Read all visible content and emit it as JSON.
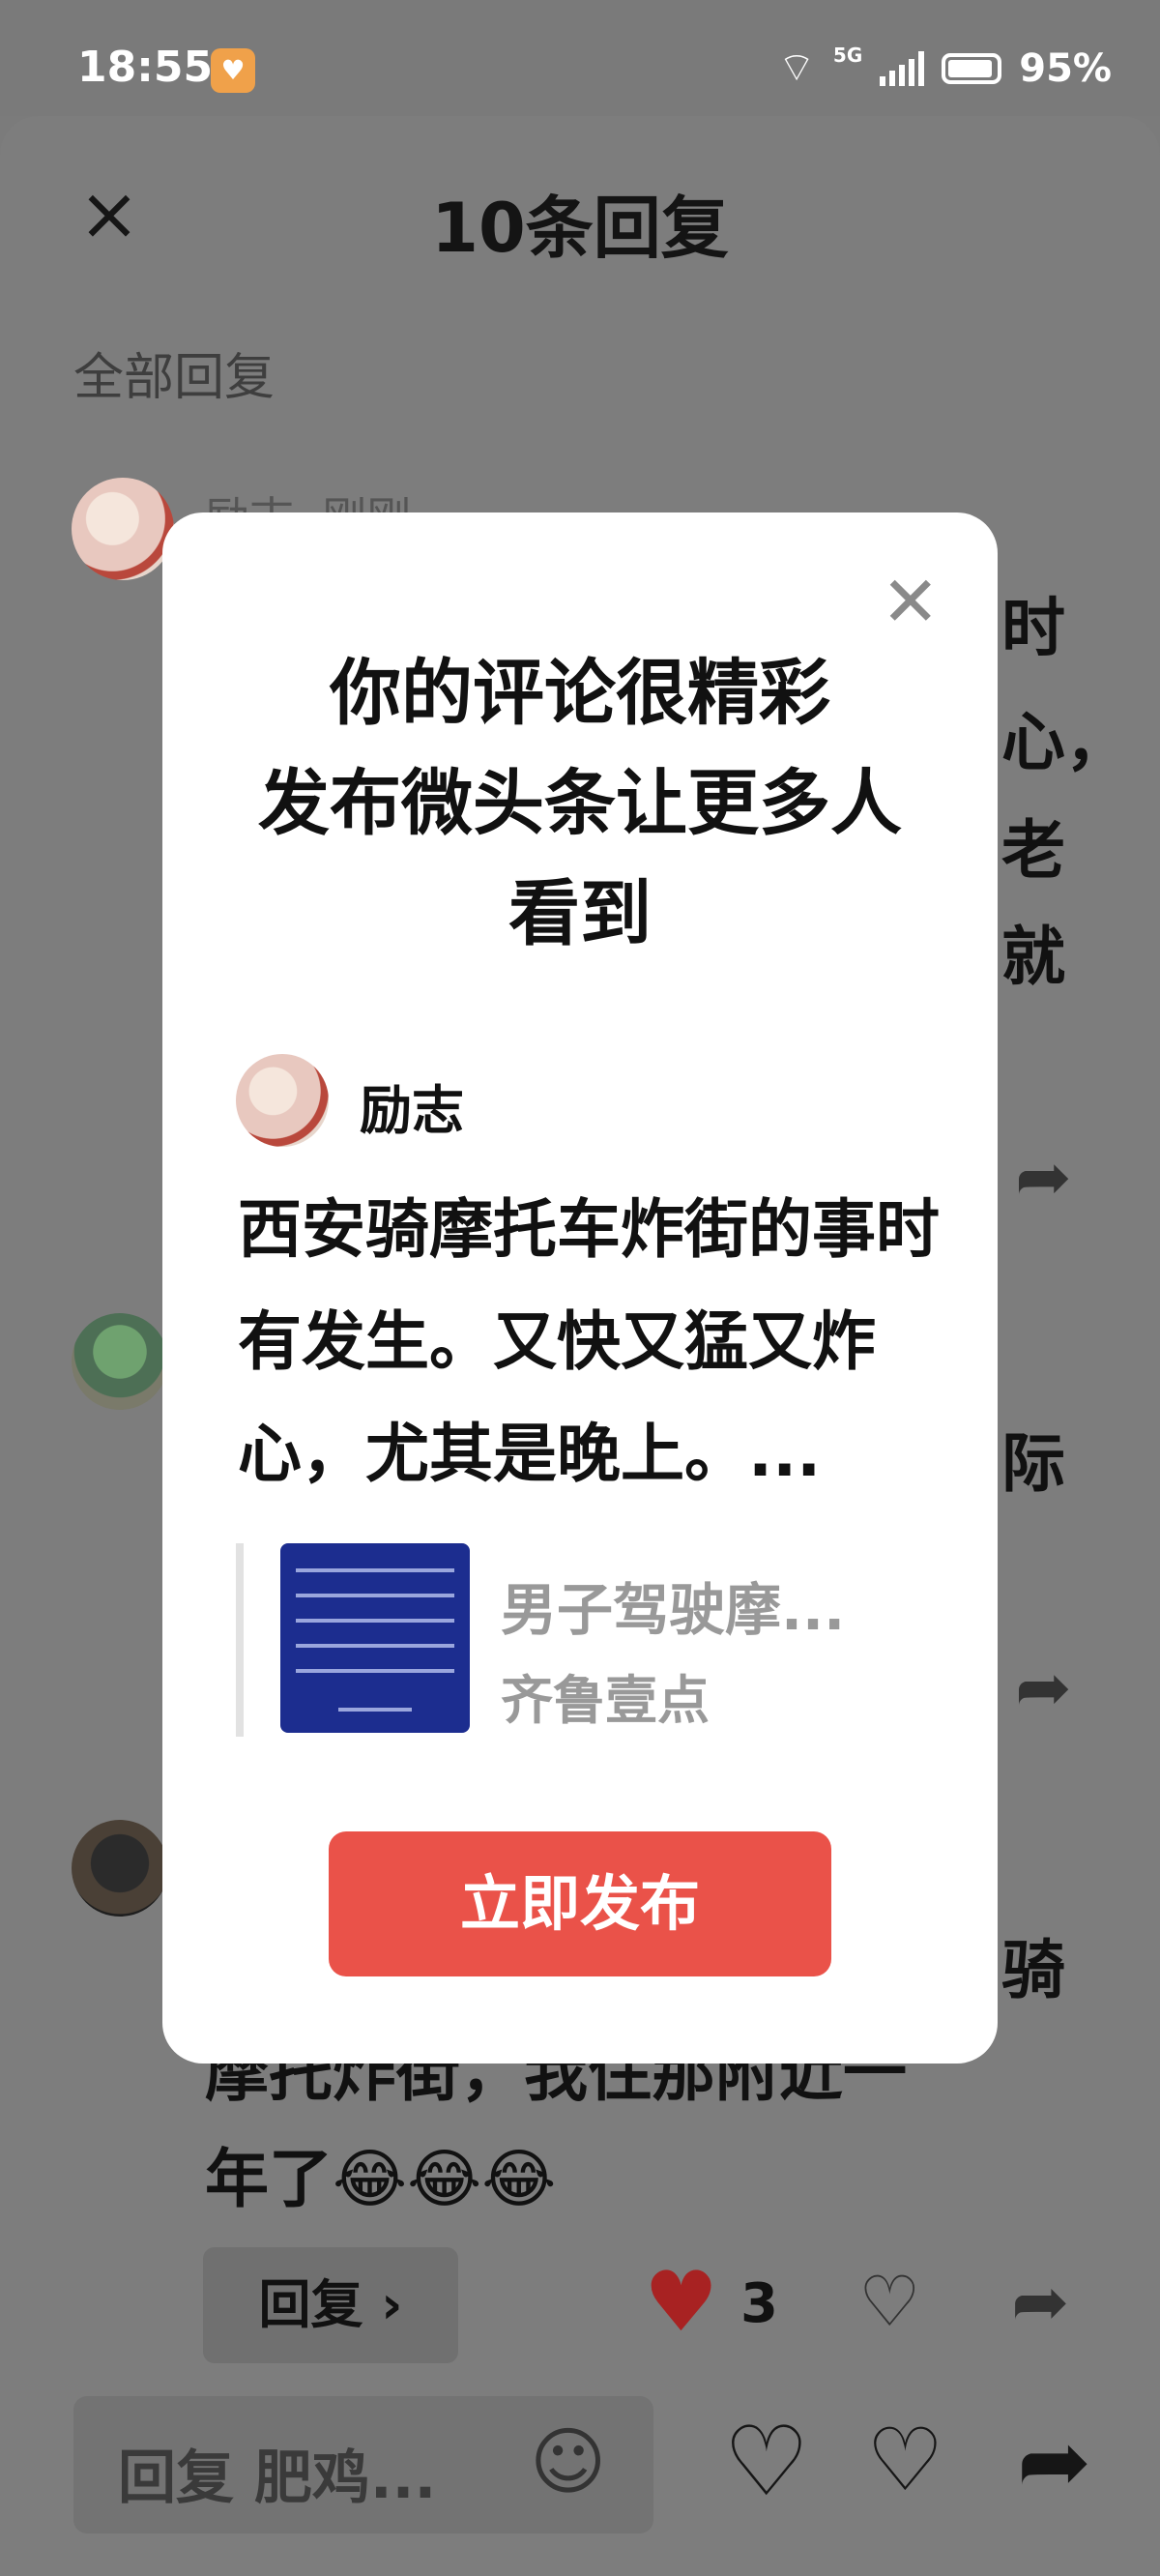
{
  "status_bar": {
    "time": "18:55",
    "network": "5G",
    "battery": "95%"
  },
  "header": {
    "title": "10条回复"
  },
  "section_label": "全部回复",
  "comments": [
    {
      "author": "励志",
      "time": "刚刚",
      "visible_tail": [
        "时",
        "心，",
        "老",
        "就"
      ]
    },
    {
      "visible_tail": [
        "际"
      ]
    },
    {
      "visible_tail": [
        "骑"
      ],
      "line2": "摩托炸街，我住那附近一",
      "line3": "年了😂😂😂"
    }
  ],
  "reply_bar": {
    "reply_label": "回复 ›",
    "like_count": "3"
  },
  "bottom_bar": {
    "input_placeholder": "回复 肥鸡..."
  },
  "modal": {
    "title": "你的评论很精彩\n发布微头条让更多人\n看到",
    "author": "励志",
    "content": "西安骑摩托车炸街的事时有发生。又快又猛又炸心，尤其是晚上。...",
    "card_title": "男子驾驶摩...",
    "card_source": "齐鲁壹点",
    "publish_label": "立即发布"
  }
}
